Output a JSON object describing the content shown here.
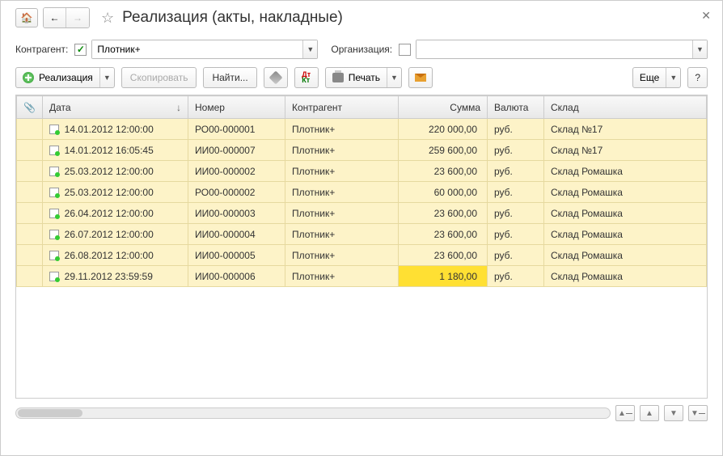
{
  "title": "Реализация (акты, накладные)",
  "filter": {
    "kontragent_label": "Контрагент:",
    "kontragent_value": "Плотник+",
    "org_label": "Организация:",
    "org_value": ""
  },
  "toolbar": {
    "realiz": "Реализация",
    "copy": "Скопировать",
    "find": "Найти...",
    "print": "Печать",
    "more": "Еще",
    "help": "?"
  },
  "columns": {
    "clip": "",
    "date": "Дата",
    "number": "Номер",
    "kontragent": "Контрагент",
    "sum": "Сумма",
    "currency": "Валюта",
    "warehouse": "Склад"
  },
  "rows": [
    {
      "date": "14.01.2012 12:00:00",
      "number": "РО00-000001",
      "kontragent": "Плотник+",
      "sum": "220 000,00",
      "currency": "руб.",
      "warehouse": "Склад №17"
    },
    {
      "date": "14.01.2012 16:05:45",
      "number": "ИИ00-000007",
      "kontragent": "Плотник+",
      "sum": "259 600,00",
      "currency": "руб.",
      "warehouse": "Склад №17"
    },
    {
      "date": "25.03.2012 12:00:00",
      "number": "ИИ00-000002",
      "kontragent": "Плотник+",
      "sum": "23 600,00",
      "currency": "руб.",
      "warehouse": "Склад Ромашка"
    },
    {
      "date": "25.03.2012 12:00:00",
      "number": "РО00-000002",
      "kontragent": "Плотник+",
      "sum": "60 000,00",
      "currency": "руб.",
      "warehouse": "Склад Ромашка"
    },
    {
      "date": "26.04.2012 12:00:00",
      "number": "ИИ00-000003",
      "kontragent": "Плотник+",
      "sum": "23 600,00",
      "currency": "руб.",
      "warehouse": "Склад Ромашка"
    },
    {
      "date": "26.07.2012 12:00:00",
      "number": "ИИ00-000004",
      "kontragent": "Плотник+",
      "sum": "23 600,00",
      "currency": "руб.",
      "warehouse": "Склад Ромашка"
    },
    {
      "date": "26.08.2012 12:00:00",
      "number": "ИИ00-000005",
      "kontragent": "Плотник+",
      "sum": "23 600,00",
      "currency": "руб.",
      "warehouse": "Склад Ромашка"
    },
    {
      "date": "29.11.2012 23:59:59",
      "number": "ИИ00-000006",
      "kontragent": "Плотник+",
      "sum": "1 180,00",
      "currency": "руб.",
      "warehouse": "Склад Ромашка",
      "highlight": true
    }
  ]
}
